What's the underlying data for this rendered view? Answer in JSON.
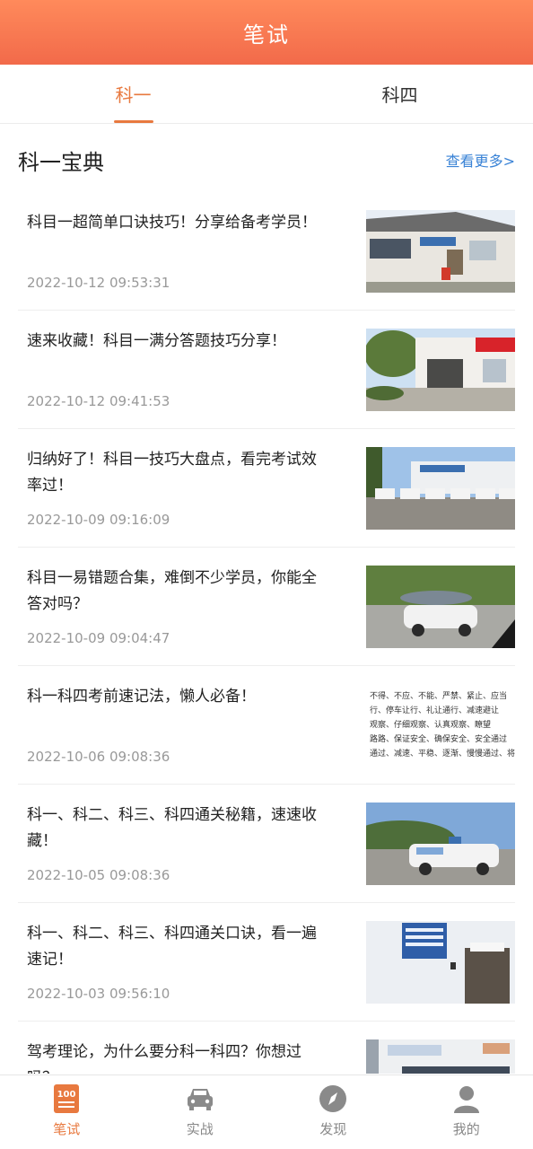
{
  "header": {
    "title": "笔试"
  },
  "tabs": [
    {
      "label": "科一",
      "active": true
    },
    {
      "label": "科四",
      "active": false
    }
  ],
  "section": {
    "title": "科一宝典",
    "more": "查看更多>"
  },
  "articles": [
    {
      "title": "科目一超简单口诀技巧！分享给备考学员！",
      "date": "2022-10-12 09:53:31",
      "thumb": "building-photo"
    },
    {
      "title": "速来收藏！科目一满分答题技巧分享！",
      "date": "2022-10-12 09:41:53",
      "thumb": "entrance-photo"
    },
    {
      "title": "归纳好了！科目一技巧大盘点，看完考试效率过！",
      "date": "2022-10-09 09:16:09",
      "thumb": "parking-lot-photo"
    },
    {
      "title": "科目一易错题合集，难倒不少学员，你能全答对吗？",
      "date": "2022-10-09 09:04:47",
      "thumb": "car-umbrella-photo"
    },
    {
      "title": "科一科四考前速记法，懒人必备！",
      "date": "2022-10-06 09:08:36",
      "thumb": "text-image",
      "thumb_lines": [
        "不得、不应、不能、严禁、紧止、应当",
        "行、停车让行、礼让通行、减速避让",
        "观察、仔细观察、认真观察、瞭望",
        "路路、保证安全、确保安全、安全通过",
        "通过、减速、平稳、逐渐、慢慢通过、将速度"
      ]
    },
    {
      "title": "科一、科二、科三、科四通关秘籍，速速收藏！",
      "date": "2022-10-05 09:08:36",
      "thumb": "training-car-photo"
    },
    {
      "title": "科一、科二、科三、科四通关口诀，看一遍速记！",
      "date": "2022-10-03 09:56:10",
      "thumb": "exam-room-photo"
    },
    {
      "title": "驾考理论，为什么要分科一科四？你想过吗？",
      "date": "",
      "thumb": "hall-photo"
    }
  ],
  "tabbar": [
    {
      "label": "笔试",
      "icon": "exam-100-icon",
      "active": true
    },
    {
      "label": "实战",
      "icon": "car-icon",
      "active": false
    },
    {
      "label": "发现",
      "icon": "compass-icon",
      "active": false
    },
    {
      "label": "我的",
      "icon": "user-icon",
      "active": false
    }
  ],
  "colors": {
    "accent": "#e8793f",
    "header_top": "#ff8a5b",
    "header_bottom": "#f26a4a",
    "link": "#3a83d6"
  }
}
